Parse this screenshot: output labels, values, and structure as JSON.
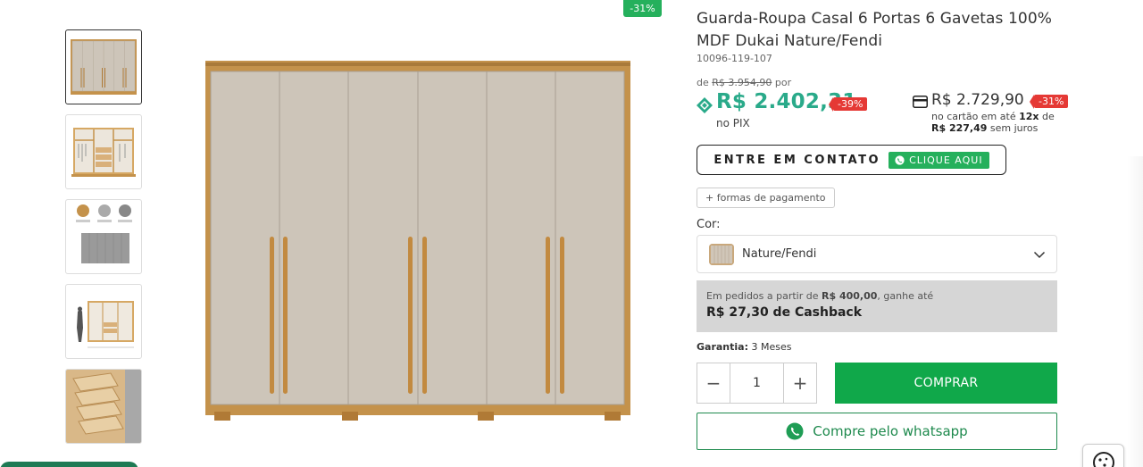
{
  "gallery": {
    "discount_badge": "-31%",
    "thumbnails": [
      {
        "label": "thumb-front-closed"
      },
      {
        "label": "thumb-open-interior"
      },
      {
        "label": "thumb-color-samples"
      },
      {
        "label": "thumb-dimensions"
      },
      {
        "label": "thumb-drawers-detail"
      }
    ]
  },
  "product": {
    "title": "Guarda-Roupa Casal 6 Portas 6 Gavetas 100% MDF Dukai Nature/Fendi",
    "sku": "10096-119-107",
    "from_prefix": "de",
    "from_price": "R$ 3.954,90",
    "from_suffix": "por",
    "pix_price": "R$ 2.402,31",
    "pix_discount": "-39%",
    "pix_label": "no PIX",
    "card_price": "R$ 2.729,90",
    "card_discount": "-31%",
    "card_terms_1": "no cartão em até",
    "card_installments": "12x",
    "card_terms_2": "de",
    "card_installment_value": "R$ 227,49",
    "card_terms_3": "sem juros"
  },
  "contact": {
    "label": "ENTRE EM CONTATO",
    "cta": "CLIQUE AQUI"
  },
  "payment_forms": "+ formas de pagamento",
  "color": {
    "label": "Cor:",
    "selected": "Nature/Fendi"
  },
  "cashback": {
    "line1_prefix": "Em pedidos a partir de",
    "threshold": "R$ 400,00",
    "line1_suffix": ", ganhe até",
    "amount_line": "R$ 27,30 de Cashback"
  },
  "warranty": {
    "label": "Garantia:",
    "value": "3 Meses"
  },
  "quantity": {
    "minus": "−",
    "value": "1",
    "plus": "+"
  },
  "buy_button": "COMPRAR",
  "whatsapp_button": "Compre pelo whatsapp",
  "colors": {
    "green": "#10a84a",
    "teal": "#2aaa8a",
    "red": "#e53935",
    "wood": "#c4924b",
    "door": "#cdc5b9"
  }
}
